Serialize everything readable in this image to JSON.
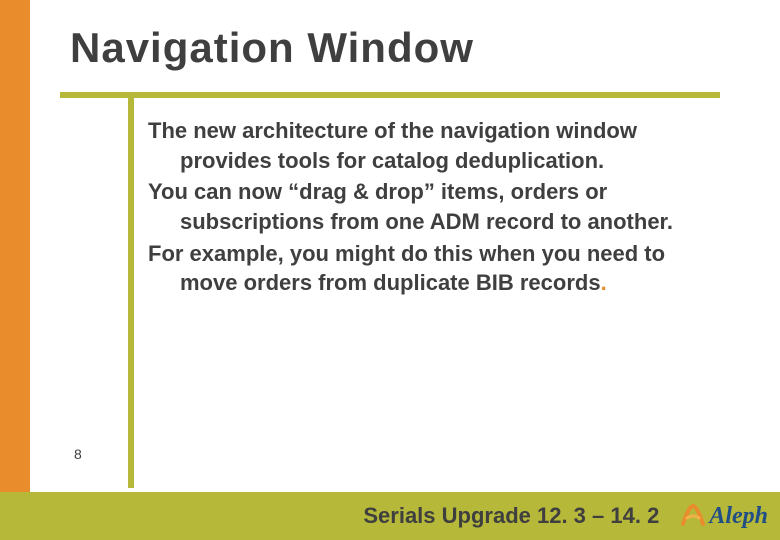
{
  "title": "Navigation Window",
  "body": {
    "p1": "The new architecture of the navigation window provides tools for catalog deduplication.",
    "p2": "You can now “drag & drop” items, orders or subscriptions from one ADM record to another.",
    "p3_a": "For example, you might do this when you need to move orders from duplicate BIB records",
    "p3_dot": "."
  },
  "page_number": "8",
  "footer": {
    "title": "Serials Upgrade 12. 3 – 14. 2",
    "logo_text": "Aleph"
  }
}
